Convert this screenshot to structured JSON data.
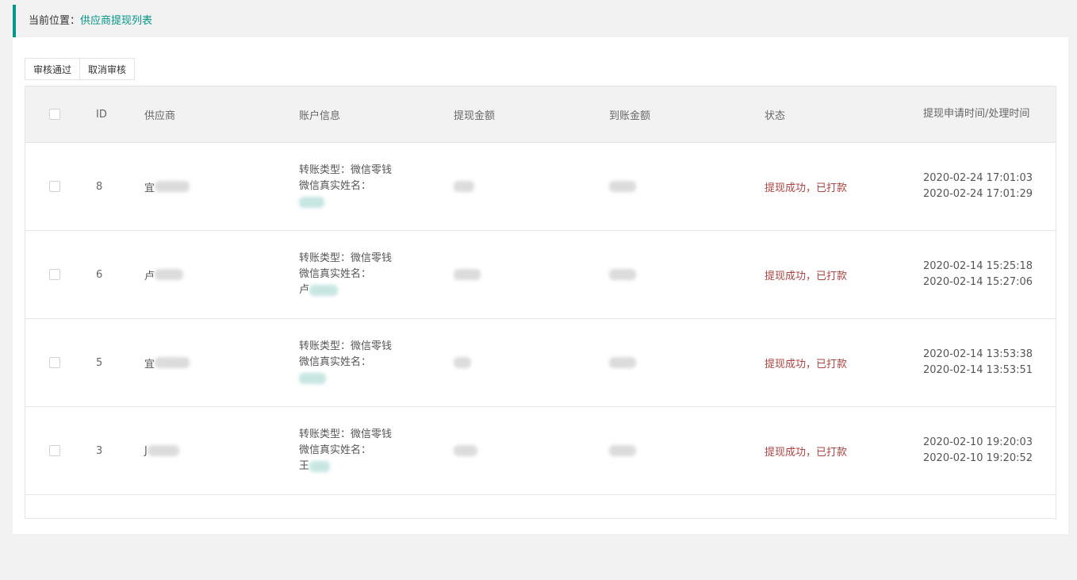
{
  "breadcrumb": {
    "prefix": "当前位置：",
    "current": "供应商提现列表"
  },
  "toolbar": {
    "approve_label": "审核通过",
    "cancel_label": "取消审核"
  },
  "table": {
    "headers": {
      "id": "ID",
      "supplier": "供应商",
      "account": "账户信息",
      "amount": "提现金额",
      "arrival": "到账金额",
      "status": "状态",
      "time": "提现申请时间/处理时间"
    },
    "rows": [
      {
        "id": "8",
        "supplier_prefix": "宜",
        "transfer_type": "转账类型：微信零钱",
        "real_name_label": "微信真实姓名：",
        "name_prefix": "",
        "status": "提现成功，已打款",
        "apply_time": "2020-02-24 17:01:03",
        "process_time": "2020-02-24 17:01:29"
      },
      {
        "id": "6",
        "supplier_prefix": "卢",
        "transfer_type": "转账类型：微信零钱",
        "real_name_label": "微信真实姓名：",
        "name_prefix": "卢",
        "status": "提现成功，已打款",
        "apply_time": "2020-02-14 15:25:18",
        "process_time": "2020-02-14 15:27:06"
      },
      {
        "id": "5",
        "supplier_prefix": "宜",
        "transfer_type": "转账类型：微信零钱",
        "real_name_label": "微信真实姓名：",
        "name_prefix": "",
        "status": "提现成功，已打款",
        "apply_time": "2020-02-14 13:53:38",
        "process_time": "2020-02-14 13:53:51"
      },
      {
        "id": "3",
        "supplier_prefix": "J",
        "transfer_type": "转账类型：微信零钱",
        "real_name_label": "微信真实姓名：",
        "name_prefix": "王",
        "status": "提现成功，已打款",
        "apply_time": "2020-02-10 19:20:03",
        "process_time": "2020-02-10 19:20:52"
      }
    ]
  },
  "colors": {
    "accent": "#009688",
    "status": "#a94442"
  }
}
